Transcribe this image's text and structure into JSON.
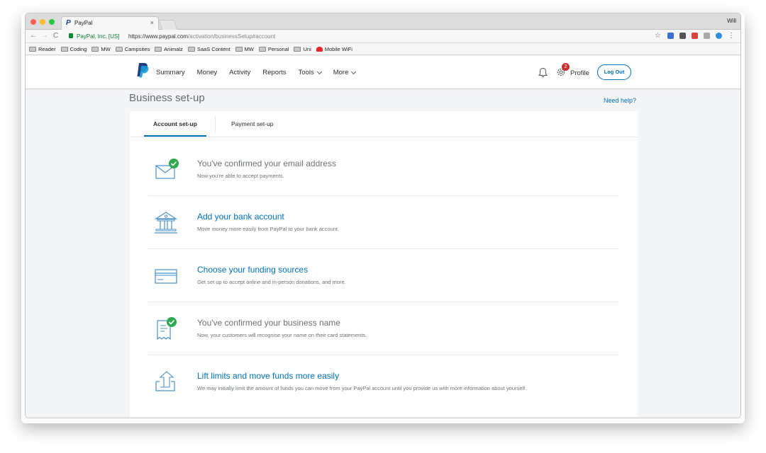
{
  "browser": {
    "tab_title": "PayPal",
    "tab_close": "×",
    "user": "Will",
    "url_org": "PayPal, Inc. [US]",
    "url_host": "https://www.paypal.com",
    "url_path": "/activation/businessSetup#account",
    "bookmarks": [
      "Reader",
      "Coding",
      "MW",
      "Campsites",
      "Animalz",
      "SaaS Content",
      "MW",
      "Personal",
      "Uni",
      "Mobile WiFi"
    ]
  },
  "header": {
    "nav": [
      "Summary",
      "Money",
      "Activity",
      "Reports",
      "Tools",
      "More"
    ],
    "notification_count": "2",
    "profile": "Profile",
    "logout": "Log Out"
  },
  "page": {
    "title": "Business set-up",
    "help": "Need help?",
    "tabs": [
      "Account set-up",
      "Payment set-up"
    ]
  },
  "steps": [
    {
      "title": "You've confirmed your email address",
      "desc": "Now you're able to accept payments.",
      "icon": "envelope-check-icon",
      "status": "done"
    },
    {
      "title": "Add your bank account",
      "desc": "Move money more easily from PayPal to your bank account.",
      "icon": "bank-icon",
      "status": "todo"
    },
    {
      "title": "Choose your funding sources",
      "desc": "Get set up to accept online and in-person donations, and more.",
      "icon": "card-icon",
      "status": "todo"
    },
    {
      "title": "You've confirmed your business name",
      "desc": "Now, your customers will recognise your name on their card statements.",
      "icon": "receipt-check-icon",
      "status": "done"
    },
    {
      "title": "Lift limits and move funds more easily",
      "desc": "We may initially limit the amount of funds you can move from your PayPal account until you provide us with more information about yourself.",
      "icon": "upload-icon",
      "status": "todo"
    }
  ],
  "colors": {
    "accent": "#0070ba",
    "check_green": "#2fa84f",
    "badge_red": "#c72e2e"
  }
}
